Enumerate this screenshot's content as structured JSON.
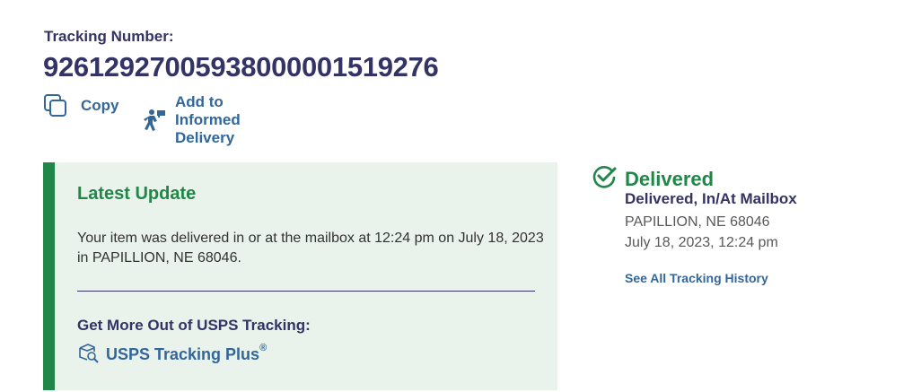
{
  "tracking": {
    "label": "Tracking Number:",
    "number": "9261292700593800000151927",
    "number_suffix": "6"
  },
  "actions": {
    "copy_label": "Copy",
    "informed_delivery_label": "Add to Informed Delivery"
  },
  "latest_update": {
    "title": "Latest Update",
    "message": "Your item was delivered in or at the mailbox at 12:24 pm on July 18, 2023 in PAPILLION, NE 68046.",
    "more_title": "Get More Out of USPS Tracking:",
    "tracking_plus_label": "USPS Tracking Plus",
    "tracking_plus_mark": "®"
  },
  "status": {
    "title": "Delivered",
    "detail": "Delivered, In/At Mailbox",
    "location": "PAPILLION, NE 68046",
    "datetime": "July 18, 2023, 12:24 pm",
    "history_link": "See All Tracking History"
  },
  "colors": {
    "navy": "#333366",
    "link_blue": "#336699",
    "success_green": "#218748",
    "panel_bg": "#eaf2ec"
  },
  "icons": {
    "copy": "copy-icon",
    "informed_delivery": "mail-carrier-icon",
    "tracking_plus": "package-search-icon",
    "delivered": "check-circle-icon"
  }
}
